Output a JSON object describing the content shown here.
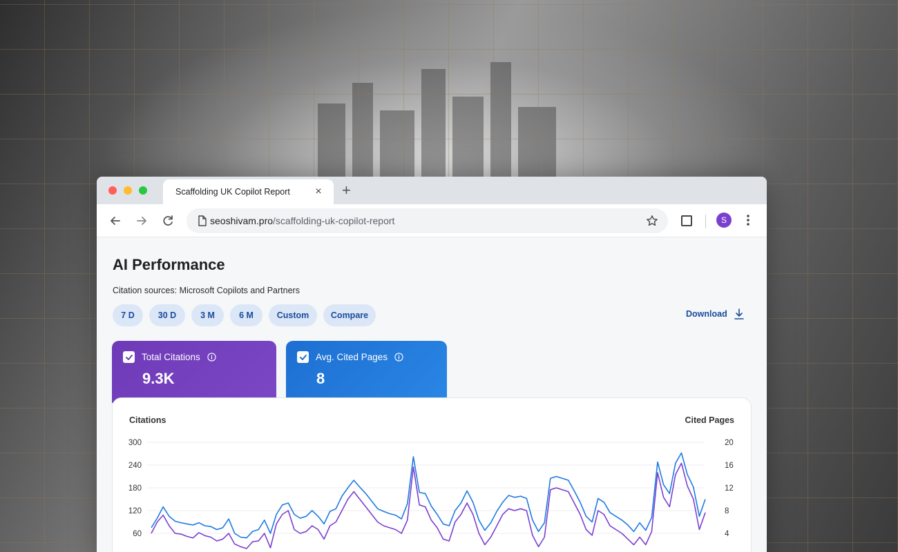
{
  "browser": {
    "tab_title": "Scaffolding UK Copilot Report",
    "tab_close": "×",
    "new_tab": "+",
    "url_host": "seoshivam.pro",
    "url_path": "/scaffolding-uk-copilot-report",
    "profile_initial": "S"
  },
  "page": {
    "title": "AI Performance",
    "subtitle": "Citation sources: Microsoft Copilots and Partners",
    "ranges": [
      {
        "label": "7 D",
        "active": false
      },
      {
        "label": "30 D",
        "active": false
      },
      {
        "label": "3 M",
        "active": true
      },
      {
        "label": "6 M",
        "active": false
      },
      {
        "label": "Custom",
        "active": false
      },
      {
        "label": "Compare",
        "active": false
      }
    ],
    "download_label": "Download",
    "metrics": [
      {
        "label": "Total Citations",
        "value": "9.3K",
        "color": "#6e3ab8",
        "checked": true
      },
      {
        "label": "Avg. Cited Pages",
        "value": "8",
        "color": "#1d6fd1",
        "checked": true
      }
    ]
  },
  "chart_data": {
    "type": "line",
    "left_axis_label": "Citations",
    "right_axis_label": "Cited Pages",
    "left_ticks": [
      "300",
      "240",
      "180",
      "120",
      "60"
    ],
    "right_ticks": [
      "20",
      "16",
      "12",
      "8",
      "4"
    ],
    "left_ylim": [
      0,
      300
    ],
    "right_ylim": [
      0,
      20
    ],
    "grid": true,
    "series": [
      {
        "color": "#7b3fd0",
        "axis": "left",
        "values": [
          60,
          90,
          108,
          80,
          60,
          58,
          52,
          48,
          62,
          54,
          50,
          40,
          45,
          60,
          32,
          25,
          20,
          38,
          40,
          60,
          22,
          85,
          110,
          120,
          70,
          60,
          65,
          80,
          70,
          45,
          80,
          90,
          120,
          150,
          170,
          150,
          130,
          110,
          90,
          80,
          75,
          70,
          60,
          95,
          235,
          135,
          130,
          95,
          75,
          45,
          40,
          90,
          110,
          140,
          110,
          60,
          30,
          50,
          80,
          110,
          125,
          120,
          125,
          120,
          55,
          25,
          50,
          175,
          180,
          175,
          170,
          140,
          110,
          70,
          55,
          120,
          110,
          80,
          70,
          60,
          45,
          30,
          50,
          30,
          65,
          220,
          155,
          130,
          215,
          245,
          185,
          150,
          70,
          115
        ]
      },
      {
        "color": "#1e7ae0",
        "axis": "left",
        "values": [
          75,
          100,
          130,
          105,
          92,
          88,
          85,
          82,
          88,
          80,
          78,
          70,
          75,
          98,
          60,
          50,
          48,
          65,
          70,
          95,
          60,
          110,
          135,
          140,
          110,
          100,
          105,
          120,
          105,
          85,
          118,
          125,
          158,
          180,
          200,
          182,
          165,
          145,
          125,
          118,
          112,
          108,
          98,
          138,
          262,
          168,
          165,
          132,
          110,
          85,
          80,
          120,
          140,
          172,
          142,
          95,
          68,
          88,
          118,
          142,
          160,
          155,
          158,
          152,
          95,
          65,
          88,
          205,
          210,
          205,
          200,
          172,
          142,
          105,
          90,
          152,
          142,
          115,
          105,
          95,
          82,
          65,
          88,
          68,
          102,
          248,
          188,
          165,
          245,
          272,
          215,
          182,
          105,
          150
        ]
      }
    ]
  }
}
